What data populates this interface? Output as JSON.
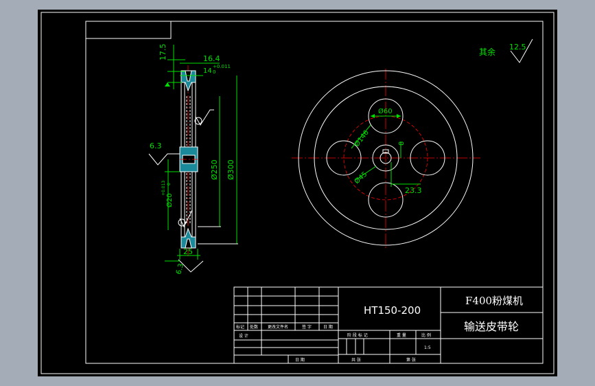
{
  "drawing": {
    "roughness_rest_label": "其余",
    "roughness_rest_value": "12.5",
    "roughness_6_3_a": "6.3",
    "roughness_6_3_b": "6.3"
  },
  "side_view": {
    "dim_17_5": "17.5",
    "dim_16_4": "16.4",
    "dim_14": "14",
    "tol_plus": "+0.011",
    "tol_zero": "0",
    "dim_d250": "Ø250",
    "dim_d300": "Ø300",
    "dim_d20": "Ø20",
    "tol_d20": "+0.013",
    "tol_d20_zero": "0",
    "dim_25": "25"
  },
  "front_view": {
    "dim_d60": "Ø60",
    "dim_d146": "Ø146",
    "dim_d45": "Ø45",
    "dim_8": "8",
    "dim_23_3": "23.3"
  },
  "title_block": {
    "material": "HT150-200",
    "product": "F400粉煤机",
    "part_name": "输送皮带轮",
    "row_labels": [
      "标记",
      "处数",
      "更改文件名",
      "签 字",
      "日 期"
    ],
    "design": "设 计",
    "date": "日 期",
    "stage_mark": "阶 段 标 记",
    "weight": "重 量",
    "scale": "比 例",
    "scale_value": "1:5",
    "total": "共   张",
    "sheet": "第   张"
  }
}
